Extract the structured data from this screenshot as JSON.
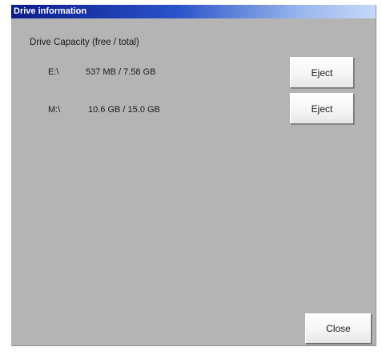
{
  "window": {
    "title": "Drive information"
  },
  "section": {
    "heading": "Drive Capacity (free / total)"
  },
  "drives": [
    {
      "letter": "E:\\",
      "capacity": "537 MB / 7.58 GB",
      "eject_label": "Eject"
    },
    {
      "letter": "M:\\",
      "capacity": "10.6 GB / 15.0 GB",
      "eject_label": "Eject"
    }
  ],
  "footer": {
    "close_label": "Close"
  },
  "colors": {
    "panel_background": "#b4b4b4",
    "titlebar_start": "#0a1c8c",
    "titlebar_end": "#c6d8f6",
    "title_text": "#ffffff"
  }
}
